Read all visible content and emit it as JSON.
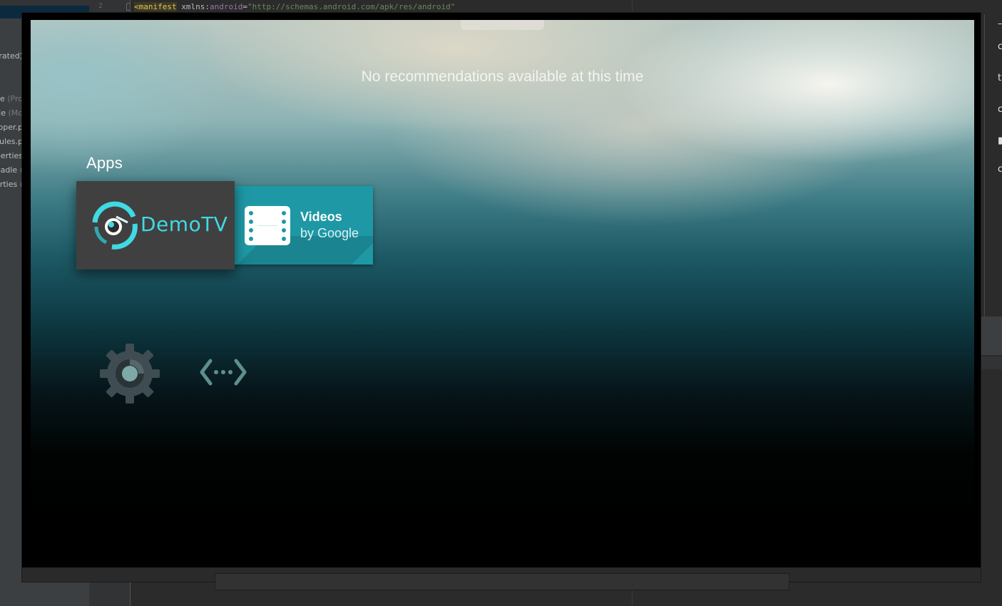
{
  "ide": {
    "project_items": [
      {
        "text": "rated)",
        "muted": ""
      },
      {
        "text": "le ",
        "muted": "(Pro"
      },
      {
        "text": "le ",
        "muted": "(Mo"
      },
      {
        "text": "pper.p",
        "muted": ""
      },
      {
        "text": "rules.p",
        "muted": ""
      },
      {
        "text": "perties",
        "muted": ""
      },
      {
        "text": "adle ",
        "muted": "("
      },
      {
        "text": "erties ",
        "muted": "("
      }
    ],
    "line_number": "2",
    "code": {
      "tag": "<manifest",
      "attr_ns": "android",
      "attr_prefix": "xmlns:",
      "equals": "=",
      "value": "\"http://schemas.android.com/apk/res/android\""
    },
    "right_panel_glyphs": [
      "–",
      "c",
      "t",
      "c",
      "▮",
      "c"
    ]
  },
  "tv_launcher": {
    "empty_message": "No recommendations available at this time",
    "apps_row_title": "Apps",
    "apps": [
      {
        "name": "DemoTV",
        "focused": true,
        "icon": "demotv-logo-icon",
        "tile_color": "#404040",
        "text_color": "#40d9e4"
      },
      {
        "name": "Videos",
        "subtitle": "by Google",
        "focused": false,
        "icon": "film-strip-icon",
        "tile_color": "#1e98a5"
      }
    ],
    "bottom_row": [
      {
        "name": "Settings",
        "icon": "settings-gear-icon"
      },
      {
        "name": "Network",
        "icon": "network-arrows-icon"
      }
    ]
  }
}
